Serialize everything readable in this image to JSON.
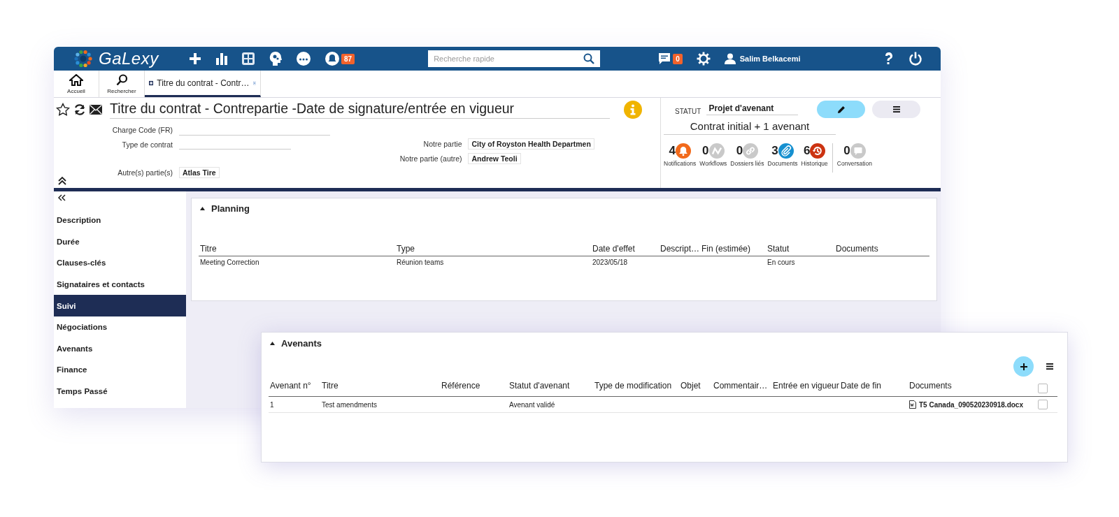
{
  "app": {
    "logo": "GaLexy",
    "alerts_badge": "87",
    "search": {
      "placeholder": "Recherche rapide"
    },
    "messages_badge": "0",
    "user": "Salim Belkacemi"
  },
  "toolbar": [
    {
      "label": "Accueil",
      "kind": "home"
    },
    {
      "label": "Rechercher",
      "kind": "search"
    }
  ],
  "tabs": [
    {
      "label": "Titre du contrat - Contr…",
      "selected": true
    }
  ],
  "record": {
    "title": "Titre du contrat - Contrepartie -Date de signature/entrée en vigueur",
    "fields_left": [
      {
        "label": "Charge Code (FR)"
      },
      {
        "label": "Type de contrat"
      },
      {
        "label": "Autre(s) partie(s)",
        "value": "Atlas Tire"
      }
    ],
    "fields_right": [
      {
        "label": "Notre partie",
        "value": "City of Royston Health Departmen"
      },
      {
        "label": "Notre partie (autre)",
        "value": "Andrew Teoli"
      }
    ]
  },
  "status": {
    "label": "STATUT",
    "value": "Projet d'avenant",
    "summary": "Contrat initial + 1 avenant"
  },
  "counters": [
    {
      "count": "4",
      "label": "Notifications",
      "kind": "bell",
      "color": "#f26a1b"
    },
    {
      "count": "0",
      "label": "Workflows",
      "kind": "workflow",
      "color": "#c9c9c9"
    },
    {
      "count": "0",
      "label": "Dossiers liés",
      "kind": "link",
      "color": "#c9c9c9"
    },
    {
      "count": "3",
      "label": "Documents",
      "kind": "paperclip",
      "color": "#1690d0"
    },
    {
      "count": "6",
      "label": "Historique",
      "kind": "history",
      "color": "#cc3311"
    },
    {
      "count": "0",
      "label": "Conversation",
      "kind": "chat",
      "color": "#c9c9c9"
    }
  ],
  "sidebar": {
    "items": [
      {
        "label": "Description",
        "selected": false
      },
      {
        "label": "Durée",
        "selected": false
      },
      {
        "label": "Clauses-clés",
        "selected": false
      },
      {
        "label": "Signataires et contacts",
        "selected": false
      },
      {
        "label": "Suivi",
        "selected": true
      },
      {
        "label": "Négociations",
        "selected": false
      },
      {
        "label": "Avenants",
        "selected": false
      },
      {
        "label": "Finance",
        "selected": false
      },
      {
        "label": "Temps Passé",
        "selected": false
      }
    ]
  },
  "planning": {
    "title": "Planning",
    "columns": [
      "Titre",
      "Type",
      "Date d'effet",
      "Descript…",
      "Fin (estimée)",
      "Statut",
      "Documents"
    ],
    "rows": [
      {
        "cells": [
          "Meeting Correction",
          "Réunion teams",
          "2023/05/18",
          null,
          null,
          "En cours",
          null
        ]
      }
    ]
  },
  "avenants": {
    "title": "Avenants",
    "select_all": {
      "checked": false
    },
    "columns": [
      {
        "label": "Avenant n°",
        "kind": "text"
      },
      {
        "label": "Titre",
        "kind": "text"
      },
      {
        "label": "Référence",
        "kind": "text"
      },
      {
        "label": "Statut d'avenant",
        "kind": "text"
      },
      {
        "label": "Type de modification",
        "kind": "text"
      },
      {
        "label": "Objet",
        "kind": "text"
      },
      {
        "label": "Commentair…",
        "kind": "text"
      },
      {
        "label": "Entrée en vigueur",
        "kind": "text"
      },
      {
        "label": "Date de fin",
        "kind": "text"
      },
      {
        "label": "Documents",
        "kind": "document"
      }
    ],
    "rows": [
      {
        "cells": [
          "1",
          "Test amendments",
          null,
          "Avenant validé",
          null,
          null,
          null,
          null,
          null,
          "T5 Canada_090520230918.docx"
        ],
        "checked": false
      }
    ]
  }
}
